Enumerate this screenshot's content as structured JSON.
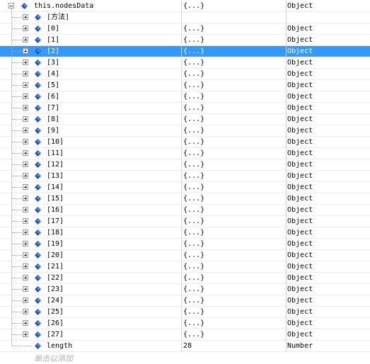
{
  "watch": {
    "root": {
      "name": "this.nodesData",
      "value": "{...}",
      "type": "Object"
    },
    "items": [
      {
        "name": "[方法]",
        "value": "",
        "type": ""
      },
      {
        "name": "[0]",
        "value": "{...}",
        "type": "Object"
      },
      {
        "name": "[1]",
        "value": "{...}",
        "type": "Object"
      },
      {
        "name": "[2]",
        "value": "{...}",
        "type": "Object",
        "selected": true
      },
      {
        "name": "[3]",
        "value": "{...}",
        "type": "Object"
      },
      {
        "name": "[4]",
        "value": "{...}",
        "type": "Object"
      },
      {
        "name": "[5]",
        "value": "{...}",
        "type": "Object"
      },
      {
        "name": "[6]",
        "value": "{...}",
        "type": "Object"
      },
      {
        "name": "[7]",
        "value": "{...}",
        "type": "Object"
      },
      {
        "name": "[8]",
        "value": "{...}",
        "type": "Object"
      },
      {
        "name": "[9]",
        "value": "{...}",
        "type": "Object"
      },
      {
        "name": "[10]",
        "value": "{...}",
        "type": "Object"
      },
      {
        "name": "[11]",
        "value": "{...}",
        "type": "Object"
      },
      {
        "name": "[12]",
        "value": "{...}",
        "type": "Object"
      },
      {
        "name": "[13]",
        "value": "{...}",
        "type": "Object"
      },
      {
        "name": "[14]",
        "value": "{...}",
        "type": "Object"
      },
      {
        "name": "[15]",
        "value": "{...}",
        "type": "Object"
      },
      {
        "name": "[16]",
        "value": "{...}",
        "type": "Object"
      },
      {
        "name": "[17]",
        "value": "{...}",
        "type": "Object"
      },
      {
        "name": "[18]",
        "value": "{...}",
        "type": "Object"
      },
      {
        "name": "[19]",
        "value": "{...}",
        "type": "Object"
      },
      {
        "name": "[20]",
        "value": "{...}",
        "type": "Object"
      },
      {
        "name": "[21]",
        "value": "{...}",
        "type": "Object"
      },
      {
        "name": "[22]",
        "value": "{...}",
        "type": "Object"
      },
      {
        "name": "[23]",
        "value": "{...}",
        "type": "Object"
      },
      {
        "name": "[24]",
        "value": "{...}",
        "type": "Object"
      },
      {
        "name": "[25]",
        "value": "{...}",
        "type": "Object"
      },
      {
        "name": "[26]",
        "value": "{...}",
        "type": "Object"
      },
      {
        "name": "[27]",
        "value": "{...}",
        "type": "Object"
      },
      {
        "name": "length",
        "value": "28",
        "type": "Number",
        "leaf": true
      }
    ],
    "add_hint": "单击以添加",
    "colors": {
      "selection": "#3399ff",
      "icon": "#1f5fb8",
      "grid": "#ececec"
    }
  }
}
